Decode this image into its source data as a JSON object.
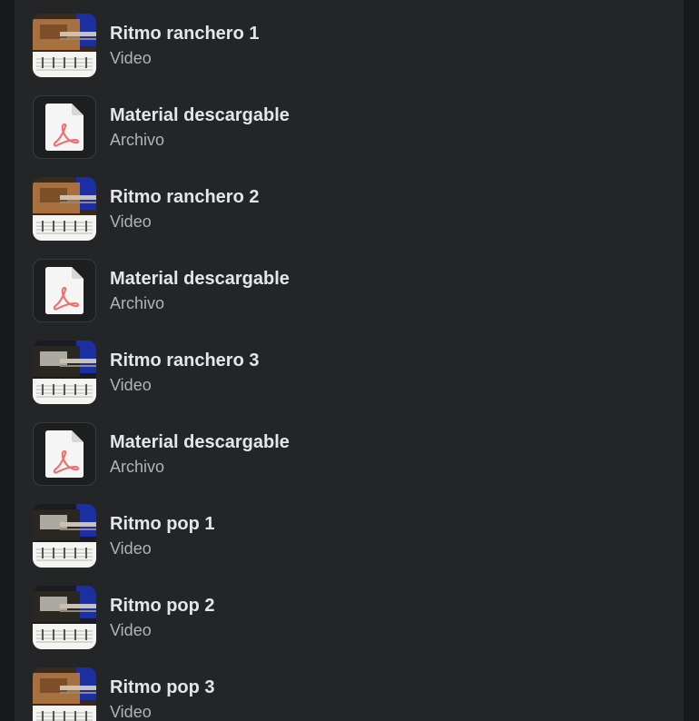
{
  "lessons": {
    "items": [
      {
        "title": "Ritmo ranchero 1",
        "type": "Video",
        "thumb": "guitar-video-thumbnail",
        "tone": "warm"
      },
      {
        "title": "Material descargable",
        "type": "Archivo",
        "thumb": "pdf-file-icon"
      },
      {
        "title": "Ritmo ranchero 2",
        "type": "Video",
        "thumb": "guitar-video-thumbnail",
        "tone": "warm"
      },
      {
        "title": "Material descargable",
        "type": "Archivo",
        "thumb": "pdf-file-icon"
      },
      {
        "title": "Ritmo ranchero 3",
        "type": "Video",
        "thumb": "guitar-video-thumbnail",
        "tone": "dark"
      },
      {
        "title": "Material descargable",
        "type": "Archivo",
        "thumb": "pdf-file-icon"
      },
      {
        "title": "Ritmo pop 1",
        "type": "Video",
        "thumb": "guitar-video-thumbnail",
        "tone": "dark"
      },
      {
        "title": "Ritmo pop 2",
        "type": "Video",
        "thumb": "guitar-video-thumbnail",
        "tone": "dark"
      },
      {
        "title": "Ritmo pop 3",
        "type": "Video",
        "thumb": "guitar-video-thumbnail",
        "tone": "warm"
      }
    ]
  },
  "colors": {
    "background": "#18191a",
    "panel": "#242526",
    "title_text": "#e4e6eb",
    "subtitle_text": "#b0b3b8",
    "pdf_accent": "#f26b6b"
  }
}
